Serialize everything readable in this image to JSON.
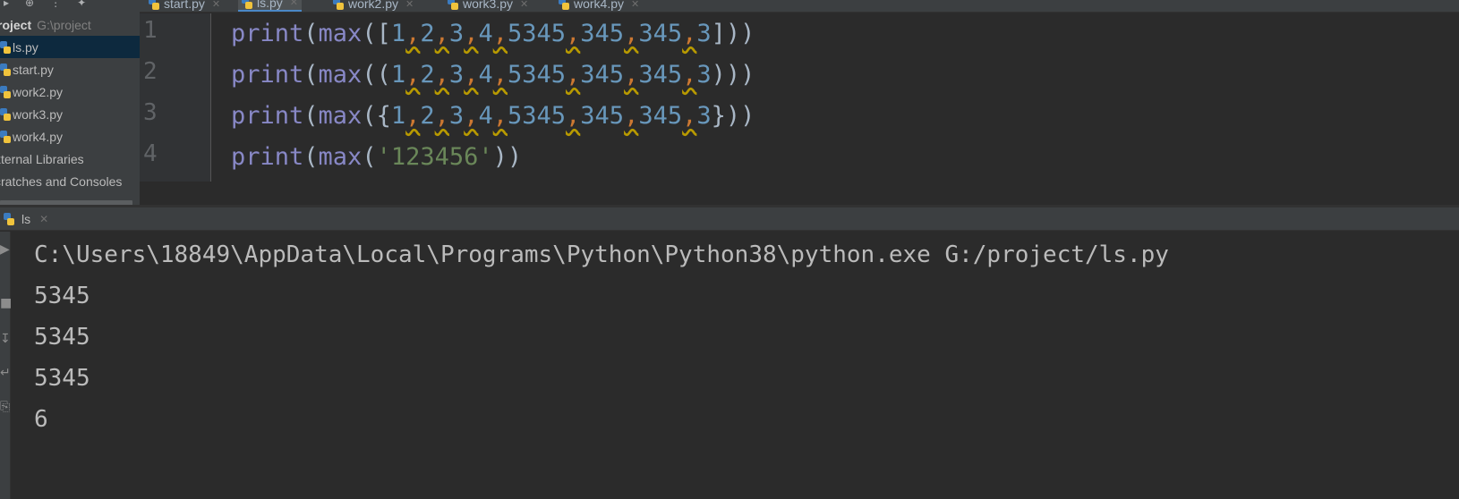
{
  "sidebar": {
    "top_icons": [
      "collapse-icon",
      "locate-icon",
      "settings-icon"
    ],
    "root": {
      "name": "roject",
      "path": "G:\\project"
    },
    "files": [
      {
        "label": "ls.py",
        "selected": true
      },
      {
        "label": "start.py",
        "selected": false
      },
      {
        "label": "work2.py",
        "selected": false
      },
      {
        "label": "work3.py",
        "selected": false
      },
      {
        "label": "work4.py",
        "selected": false
      }
    ],
    "external_libraries": "xternal Libraries",
    "scratches": "cratches and Consoles"
  },
  "editor": {
    "tabs": [
      {
        "label": "start.py",
        "active": false
      },
      {
        "label": "ls.py",
        "active": true
      },
      {
        "label": "work2.py",
        "active": false
      },
      {
        "label": "work3.py",
        "active": false
      },
      {
        "label": "work4.py",
        "active": false
      }
    ],
    "line_numbers": [
      "1",
      "2",
      "3",
      "4"
    ],
    "lines": [
      "print(max([1,2,3,4,5345,345,345,3]))",
      "print(max((1,2,3,4,5345,345,345,3)))",
      "print(max({1,2,3,4,5345,345,345,3}))",
      "print(max('123456'))"
    ]
  },
  "run": {
    "tab_label": "ls",
    "output": [
      "C:\\Users\\18849\\AppData\\Local\\Programs\\Python\\Python38\\python.exe G:/project/ls.py",
      "5345",
      "5345",
      "5345",
      "6"
    ]
  },
  "colors": {
    "background": "#2b2b2b",
    "panel": "#3c3f41",
    "keyword_builtin": "#8888c6",
    "number": "#6897bb",
    "string": "#6a8759",
    "comma": "#cc7832",
    "selection": "#0d293e",
    "accent": "#4a88c7"
  }
}
